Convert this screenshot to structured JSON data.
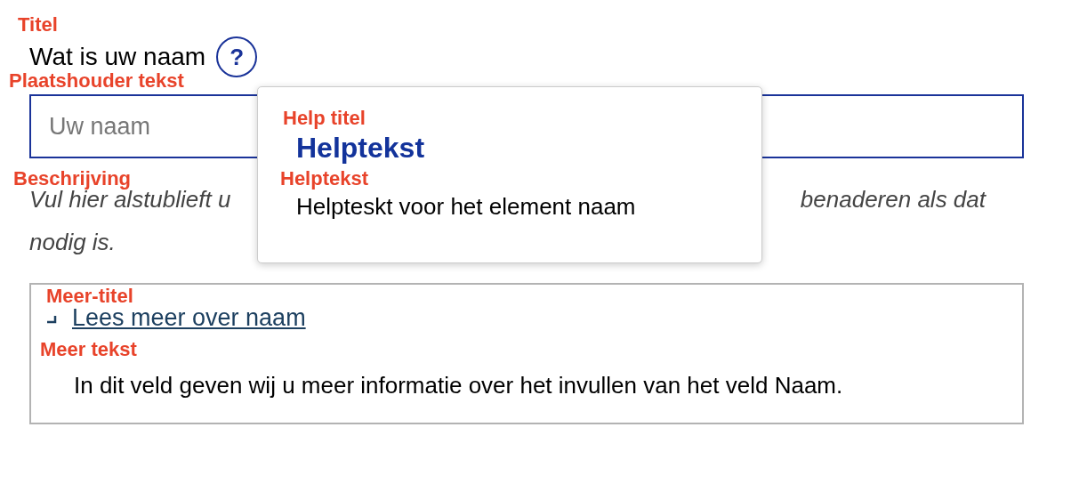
{
  "annotations": [
    {
      "text": "Titel"
    },
    {
      "text": "Plaatshouder tekst"
    },
    {
      "text": "Beschrijving"
    },
    {
      "text": "Help titel"
    },
    {
      "text": "Helptekst"
    },
    {
      "text": "Meer-titel"
    },
    {
      "text": "Meer tekst"
    }
  ],
  "field": {
    "title": "Wat is uw naam",
    "help_icon": "?",
    "placeholder": "Uw naam",
    "description": {
      "line_1_start": "Vul hier alstublieft u",
      "line_1_end": "benaderen als dat",
      "line_2": "nodig is."
    }
  },
  "help_popover": {
    "title": "Helptekst",
    "text": "Helpteskt voor het element naam"
  },
  "more": {
    "link": "Lees meer over naam",
    "expanded": true,
    "text": "In dit veld geven wij u meer informatie over het invullen van het veld Naam."
  }
}
